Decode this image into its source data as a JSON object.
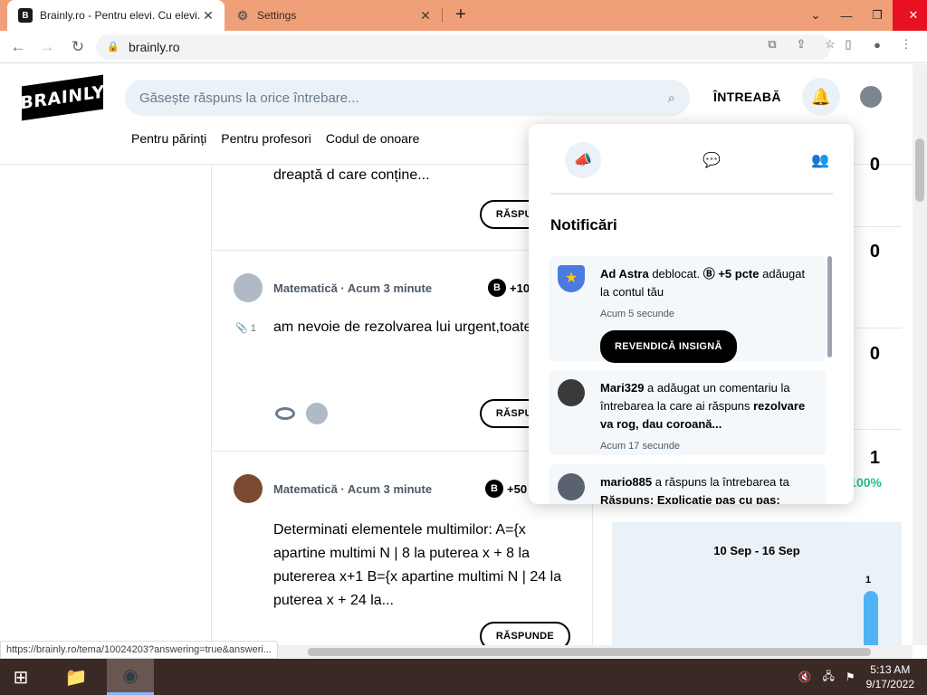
{
  "browser": {
    "tabs": [
      {
        "title": "Brainly.ro - Pentru elevi. Cu elevi.",
        "favicon": "B",
        "active": true
      },
      {
        "title": "Settings",
        "favicon": "gear-icon",
        "active": false
      }
    ],
    "url": "brainly.ro",
    "status_url": "https://brainly.ro/tema/10024203?answering=true&answeri..."
  },
  "header": {
    "logo": "BRAINLY",
    "search_placeholder": "Găsește răspuns la orice întrebare...",
    "ask_label": "ÎNTREABĂ",
    "nav": [
      "Pentru părinți",
      "Pentru profesori",
      "Codul de onoare"
    ]
  },
  "feed": {
    "q0": {
      "text": "dreaptă d care conține...",
      "answer_label": "RĂSPUNDE"
    },
    "q1": {
      "meta": "Matematică · Acum 3 minute",
      "points": "+10",
      "attachments": "1",
      "text": "am nevoie de rezolvarea lui urgent,toate cele trei puncte de efectuat,varog frumos",
      "answer_label": "RĂSPUNDE"
    },
    "q2": {
      "meta": "Matematică · Acum 3 minute",
      "points": "+50",
      "text": "Determinati elementele multimilor: A={x apartine multimi N | 8 la puterea x + 8 la putererea x+1 B={x apartine multimi N | 24 la puterea x + 24 la...",
      "answer_label": "RĂSPUNDE"
    }
  },
  "sidebar": {
    "stats": [
      "0",
      "0",
      "0",
      "1"
    ],
    "percent": "100%",
    "week": "10 Sep - 16 Sep",
    "bar_value": "1"
  },
  "notifications": {
    "title": "Notificări",
    "items": [
      {
        "user": "Ad Astra",
        "text": " deblocat. ",
        "points": "+5 pcte",
        "text2": " adăugat la contul tău",
        "time": "Acum 5 secunde",
        "button": "REVENDICĂ INSIGNĂ"
      },
      {
        "user": "Mari329",
        "text": " a adăugat un comentariu la întrebarea la care ai răspuns ",
        "bold": "rezolvare va rog, dau coroană...",
        "time": "Acum 17 secunde"
      },
      {
        "user": "mario885",
        "text": " a răspuns la întrebarea ta ",
        "bold": "Răspuns: Explicație pas cu pas:",
        "time": ""
      }
    ]
  },
  "taskbar": {
    "time": "5:13 AM",
    "date": "9/17/2022"
  },
  "colors": {
    "tabstrip": "#f0a078",
    "search_bg": "#ebf2f7",
    "accent_blue": "#4fb3f6",
    "success": "#26c184"
  }
}
